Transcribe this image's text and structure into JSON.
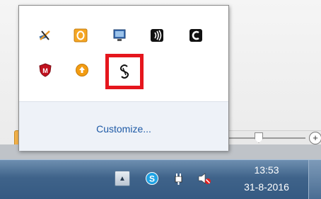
{
  "app": {
    "accent_orange": "#f3b24a",
    "zoom_in_symbol": "+"
  },
  "popup": {
    "icons": [
      {
        "name": "network-tools-icon"
      },
      {
        "name": "outlook-icon"
      },
      {
        "name": "display-icon"
      },
      {
        "name": "wifi-icon"
      },
      {
        "name": "c-app-icon"
      },
      {
        "name": "mcafee-shield-icon"
      },
      {
        "name": "update-arrow-icon"
      },
      {
        "name": "s-link-icon"
      }
    ],
    "customize_label": "Customize...",
    "highlight_color": "#e5161d"
  },
  "taskbar": {
    "show_hidden_symbol": "▲",
    "tray_icons": [
      {
        "name": "skype-icon"
      },
      {
        "name": "power-plug-icon"
      },
      {
        "name": "volume-muted-icon"
      }
    ],
    "clock": {
      "time": "13:53",
      "date": "31-8-2016"
    }
  }
}
